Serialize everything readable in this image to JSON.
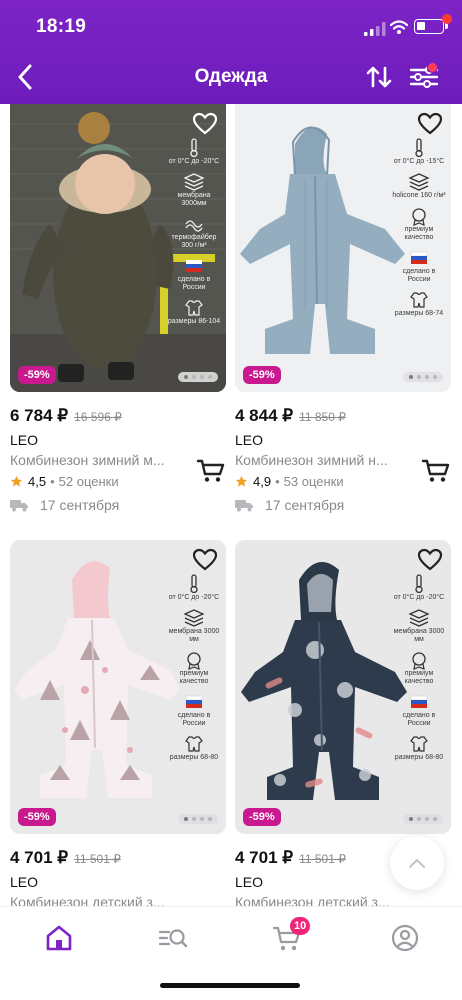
{
  "status": {
    "time": "18:19"
  },
  "nav": {
    "title": "Одежда"
  },
  "colors": {
    "header": "#7d24c7",
    "discount_badge": "#c8198f",
    "star": "#f0a020",
    "cart_badge": "#f0257a",
    "active_tab": "#7d24c7"
  },
  "products": [
    {
      "price": "6 784 ₽",
      "old_price": "16 596 ₽",
      "brand": "LEO",
      "name": "Комбинезон зимний м...",
      "rating": "4,5",
      "reviews": "52 оценки",
      "delivery": "17 сентября",
      "discount": "-59%",
      "features": [
        "от 0°C до -20°C",
        "мембрана 3000мм",
        "термофайбер 300 г/м²",
        "сделано в России",
        "размеры 86-104"
      ]
    },
    {
      "price": "4 844 ₽",
      "old_price": "11 850 ₽",
      "brand": "LEO",
      "name": "Комбинезон зимний н...",
      "rating": "4,9",
      "reviews": "53 оценки",
      "delivery": "17 сентября",
      "discount": "-59%",
      "features": [
        "от 0°C до -15°C",
        "holicone 160 г/м²",
        "премиум качество",
        "сделано в России",
        "размеры 68-74"
      ]
    },
    {
      "price": "4 701 ₽",
      "old_price": "11 501 ₽",
      "brand": "LEO",
      "name": "Комбинезон детский з...",
      "discount": "-59%",
      "features": [
        "от 0°C до -20°C",
        "мембрана 3000 мм",
        "премиум качество",
        "сделано в России",
        "размеры 68-80"
      ]
    },
    {
      "price": "4 701 ₽",
      "old_price": "11 501 ₽",
      "brand": "LEO",
      "name": "Комбинезон детский з...",
      "discount": "-59%",
      "features": [
        "от 0°C до -20°C",
        "мембрана 3000 мм",
        "премиум качество",
        "сделано в России",
        "размеры 68-80"
      ]
    }
  ],
  "tabbar": {
    "items": [
      "home-icon",
      "catalog-search-icon",
      "cart-icon",
      "profile-icon"
    ],
    "cart_badge": "10"
  }
}
